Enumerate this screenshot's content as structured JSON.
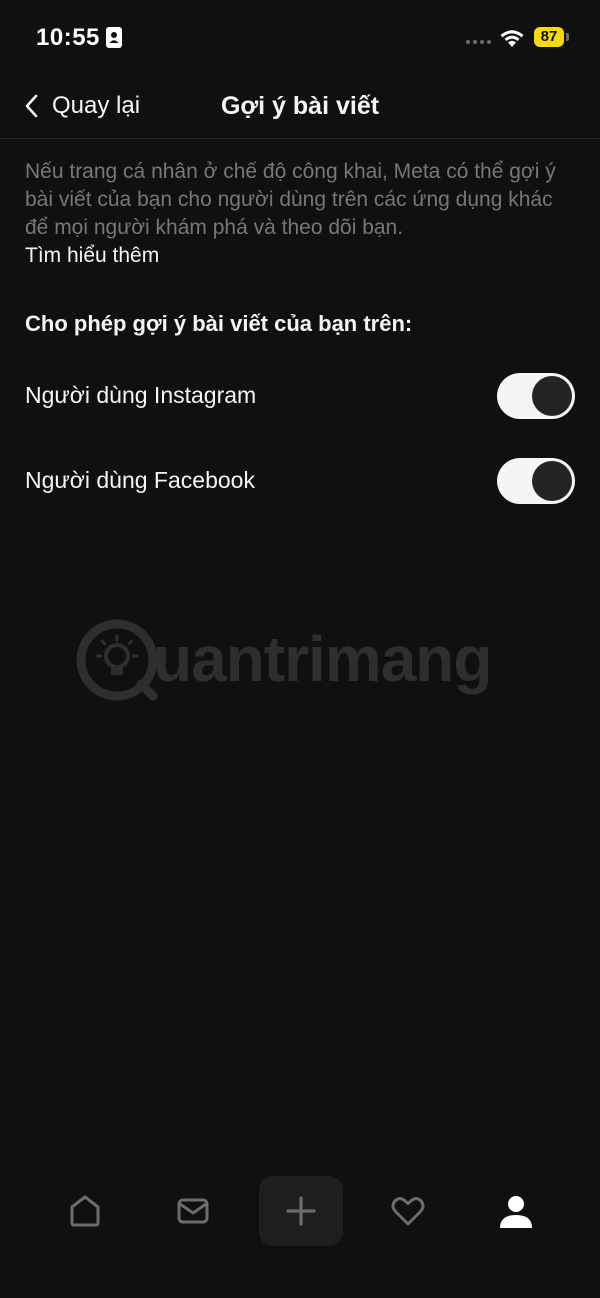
{
  "status_bar": {
    "time": "10:55",
    "battery_level": "87",
    "battery_color": "#f5d90a",
    "icons": [
      "id-card-icon",
      "signal-dots-icon",
      "wifi-icon",
      "battery-icon"
    ]
  },
  "header": {
    "back_label": "Quay lại",
    "title": "Gợi ý bài viết"
  },
  "content": {
    "description": "Nếu trang cá nhân ở chế độ công khai, Meta có thể gợi ý bài viết của bạn cho người dùng trên các ứng dụng khác để mọi người khám phá và theo dõi bạn.",
    "learn_more": "Tìm hiểu thêm",
    "section_heading": "Cho phép gợi ý bài viết của bạn trên:",
    "toggles": [
      {
        "label": "Người dùng Instagram",
        "enabled": true
      },
      {
        "label": "Người dùng Facebook",
        "enabled": true
      }
    ]
  },
  "watermark": {
    "text": "uantrimang"
  },
  "bottom_nav": {
    "items": [
      "home-icon",
      "inbox-icon",
      "create-icon",
      "activity-heart-icon",
      "profile-icon"
    ],
    "active": "profile-icon"
  }
}
